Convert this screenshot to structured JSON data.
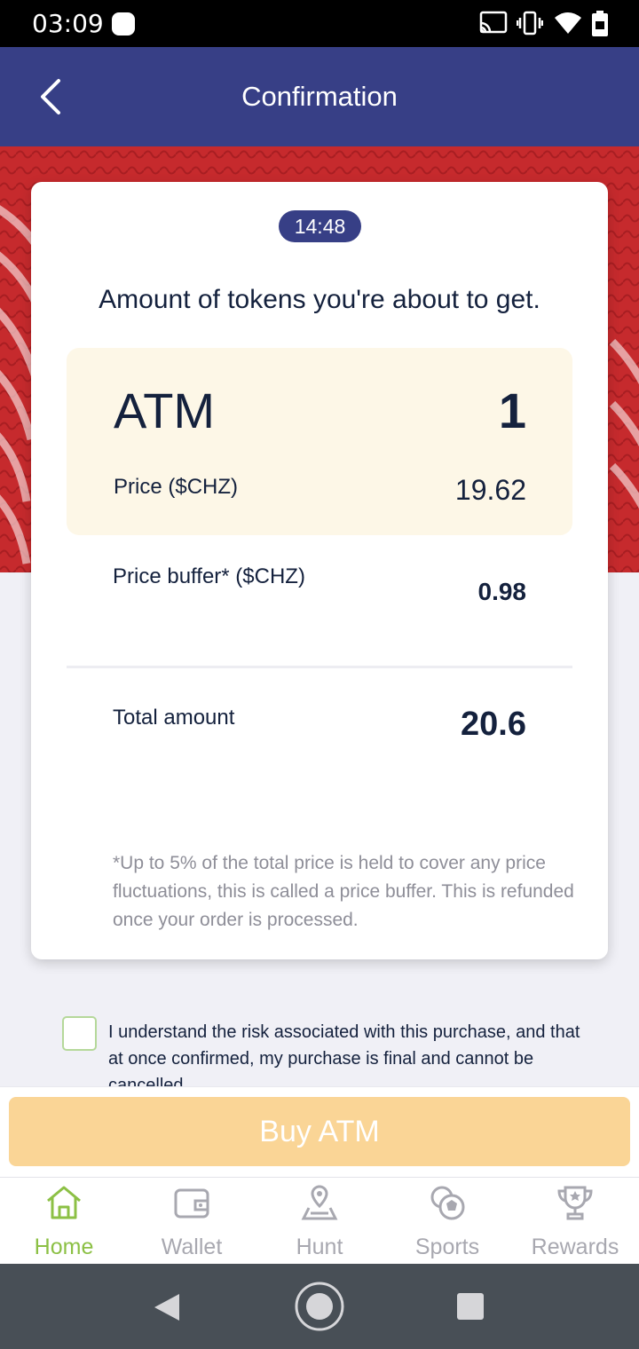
{
  "status_bar": {
    "time": "03:09",
    "icons": [
      "notification-dot-icon",
      "cast-icon",
      "vibrate-icon",
      "wifi-icon",
      "battery-icon"
    ]
  },
  "app_bar": {
    "title": "Confirmation",
    "back_icon": "chevron-left-icon"
  },
  "card": {
    "timer": "14:48",
    "heading": "Amount of tokens you're about to get.",
    "token": "ATM",
    "quantity": "1",
    "price_label": "Price ($CHZ)",
    "price_value": "19.62",
    "buffer_label": "Price buffer* ($CHZ)",
    "buffer_value": "0.98",
    "total_label": "Total amount",
    "total_value": "20.6",
    "note": "*Up to 5% of the total price is held to cover any price fluctuations, this is called a price buffer. This is refunded once your order is processed."
  },
  "consent": {
    "text": "I understand the risk associated with this purchase, and that at once confirmed, my purchase is final and cannot be cancelled."
  },
  "buy_button": {
    "label": "Buy ATM"
  },
  "bottom_nav": [
    {
      "label": "Home",
      "icon": "home-icon",
      "active": true
    },
    {
      "label": "Wallet",
      "icon": "wallet-icon",
      "active": false
    },
    {
      "label": "Hunt",
      "icon": "map-pin-icon",
      "active": false
    },
    {
      "label": "Sports",
      "icon": "ball-icon",
      "active": false
    },
    {
      "label": "Rewards",
      "icon": "trophy-icon",
      "active": false
    }
  ],
  "colors": {
    "primary": "#373f86",
    "banner": "#c62a2d",
    "highlight_bg": "#fdf7e7",
    "button_disabled": "#fad596",
    "nav_active": "#8cc045",
    "nav_inactive": "#a8a8b0"
  }
}
